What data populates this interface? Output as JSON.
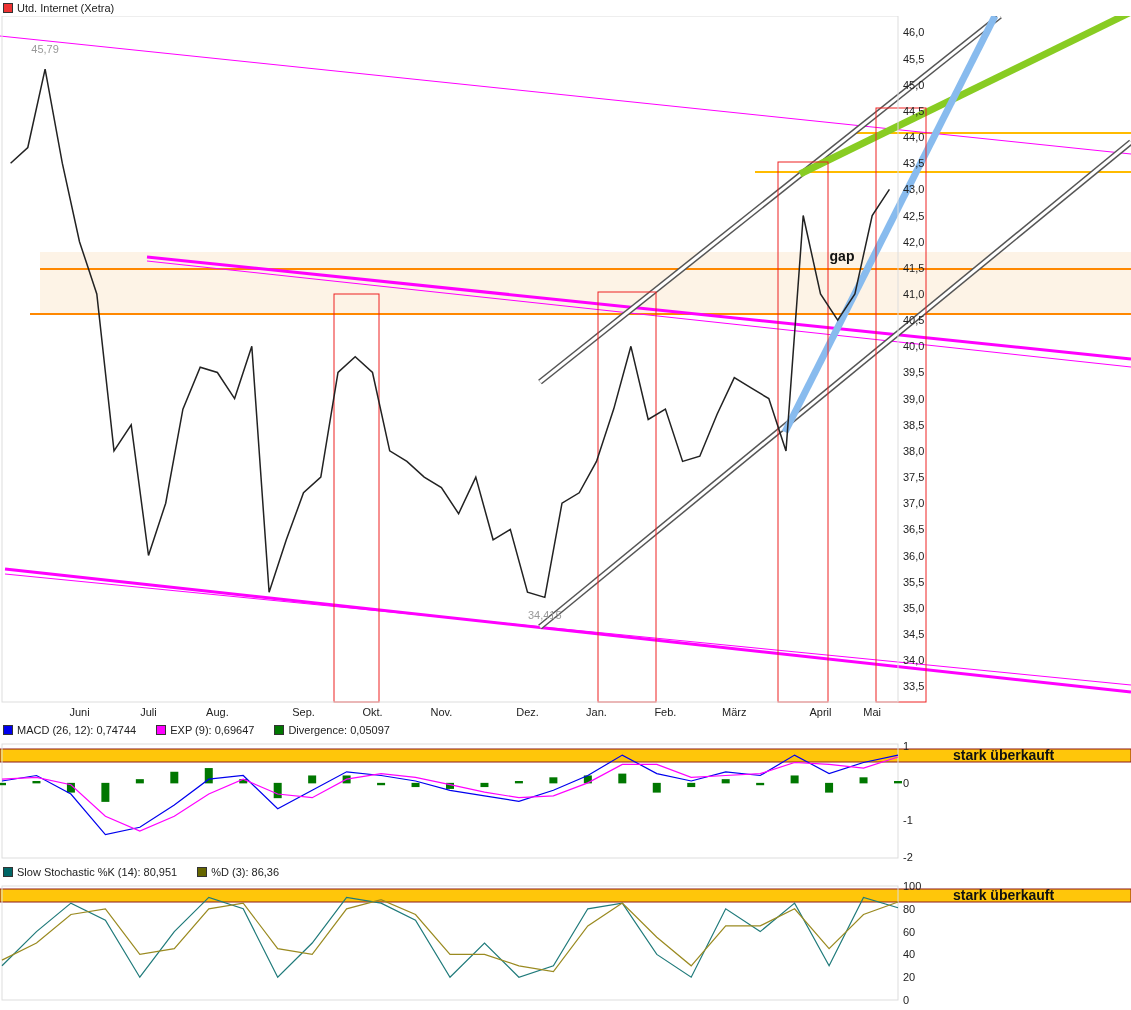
{
  "price_panel": {
    "legend": {
      "label": "Utd. Internet (Xetra)",
      "color": "#ee3333"
    },
    "chart_data": {
      "type": "line",
      "categories": [
        null,
        null,
        null,
        null,
        "Juni",
        null,
        null,
        null,
        "Juli",
        null,
        null,
        null,
        "Aug.",
        null,
        null,
        null,
        null,
        "Sep.",
        null,
        null,
        null,
        "Okt.",
        null,
        null,
        null,
        "Nov.",
        null,
        null,
        null,
        null,
        "Dez.",
        null,
        null,
        null,
        "Jan.",
        null,
        null,
        null,
        "Feb.",
        null,
        null,
        null,
        "März",
        null,
        null,
        null,
        null,
        "April",
        null,
        null,
        "Mai",
        null
      ],
      "series": [
        {
          "color": "#222222",
          "values": [
            43.5,
            43.8,
            45.3,
            43.5,
            42.0,
            41.0,
            38.0,
            38.5,
            36.0,
            37.0,
            38.8,
            39.6,
            39.5,
            39.0,
            40.0,
            35.3,
            36.3,
            37.2,
            37.5,
            39.5,
            39.8,
            39.5,
            38.0,
            37.8,
            37.5,
            37.3,
            36.8,
            37.5,
            36.3,
            36.5,
            35.3,
            35.2,
            37.0,
            37.2,
            37.8,
            38.8,
            40.0,
            38.6,
            38.8,
            37.8,
            37.9,
            38.7,
            39.4,
            39.2,
            39.0,
            38.0,
            42.5,
            41.0,
            40.5,
            41.0,
            42.5,
            43.0
          ]
        }
      ],
      "ylim": [
        33.2,
        46.2
      ],
      "yticks": [
        {
          "value": 33.5,
          "label": "33,5"
        },
        {
          "value": 34,
          "label": "34,0"
        },
        {
          "value": 34.5,
          "label": "34,5"
        },
        {
          "value": 35,
          "label": "35,0"
        },
        {
          "value": 35.5,
          "label": "35,5"
        },
        {
          "value": 36,
          "label": "36,0"
        },
        {
          "value": 36.5,
          "label": "36,5"
        },
        {
          "value": 37,
          "label": "37,0"
        },
        {
          "value": 37.5,
          "label": "37,5"
        },
        {
          "value": 38,
          "label": "38,0"
        },
        {
          "value": 38.5,
          "label": "38,5"
        },
        {
          "value": 39,
          "label": "39,0"
        },
        {
          "value": 39.5,
          "label": "39,5"
        },
        {
          "value": 40,
          "label": "40,0"
        },
        {
          "value": 40.5,
          "label": "40,5"
        },
        {
          "value": 41,
          "label": "41,0"
        },
        {
          "value": 41.5,
          "label": "41,5"
        },
        {
          "value": 42,
          "label": "42,0"
        },
        {
          "value": 42.5,
          "label": "42,5"
        },
        {
          "value": 43,
          "label": "43,0"
        },
        {
          "value": 43.5,
          "label": "43,5"
        },
        {
          "value": 44,
          "label": "44,0"
        },
        {
          "value": 44.5,
          "label": "44,5"
        },
        {
          "value": 45,
          "label": "45,0"
        },
        {
          "value": 45.5,
          "label": "45,5"
        },
        {
          "value": 46,
          "label": "46,0"
        }
      ],
      "annotations": [
        "45,79",
        "34,415",
        "gap"
      ]
    }
  },
  "macd_panel": {
    "legend": [
      {
        "label": "MACD (26, 12): 0,74744",
        "color": "#0000ee"
      },
      {
        "label": "EXP (9): 0,69647",
        "color": "#ff00ff"
      },
      {
        "label": "Divergence: 0,05097",
        "color": "#007700"
      }
    ],
    "chart_data": {
      "type": "line",
      "categories": [
        null,
        null,
        null,
        null,
        null,
        null,
        null,
        null,
        null,
        null,
        null,
        null,
        null,
        null,
        null,
        null,
        null,
        null,
        null,
        null,
        null,
        null,
        null,
        null,
        null,
        null,
        null
      ],
      "series": [
        {
          "color": "#0000ee",
          "values": [
            0.05,
            0.2,
            -0.3,
            -1.4,
            -1.2,
            -0.6,
            0.1,
            0.2,
            -0.7,
            -0.2,
            0.3,
            0.2,
            0.05,
            -0.2,
            -0.35,
            -0.5,
            -0.2,
            0.2,
            0.75,
            0.25,
            0.05,
            0.3,
            0.2,
            0.75,
            0.25,
            0.55,
            0.75
          ]
        },
        {
          "color": "#ff00ff",
          "values": [
            0.1,
            0.15,
            -0.05,
            -0.9,
            -1.3,
            -0.9,
            -0.3,
            0.1,
            -0.3,
            -0.4,
            0.1,
            0.25,
            0.15,
            -0.05,
            -0.25,
            -0.4,
            -0.35,
            0,
            0.5,
            0.5,
            0.15,
            0.2,
            0.25,
            0.55,
            0.5,
            0.4,
            0.7
          ]
        },
        {
          "color": "#007700",
          "type": "bar",
          "values": [
            -0.05,
            0.05,
            -0.25,
            -0.5,
            0.1,
            0.3,
            0.4,
            0.1,
            -0.4,
            0.2,
            0.2,
            -0.05,
            -0.1,
            -0.15,
            -0.1,
            0.05,
            0.15,
            0.2,
            0.25,
            -0.25,
            -0.1,
            0.1,
            -0.05,
            0.2,
            -0.25,
            0.15,
            0.05
          ]
        }
      ],
      "ylim": [
        -2.03,
        1.05
      ],
      "yticks": [
        -2,
        -1,
        0,
        1
      ]
    },
    "banner": "stark überkauft"
  },
  "stochastic_panel": {
    "legend": [
      {
        "label": "Slow Stochastic %K (14): 80,951",
        "color": "#006666"
      },
      {
        "label": "%D (3): 86,36",
        "color": "#666600"
      }
    ],
    "chart_data": {
      "type": "line",
      "categories": [
        null,
        null,
        null,
        null,
        null,
        null,
        null,
        null,
        null,
        null,
        null,
        null,
        null,
        null,
        null,
        null,
        null,
        null,
        null,
        null,
        null,
        null,
        null,
        null,
        null,
        null,
        null
      ],
      "series": [
        {
          "color": "#1f7a7a",
          "values": [
            30,
            60,
            85,
            70,
            20,
            60,
            90,
            80,
            20,
            50,
            90,
            85,
            70,
            20,
            50,
            20,
            30,
            80,
            85,
            40,
            20,
            80,
            60,
            85,
            30,
            90,
            81
          ]
        },
        {
          "color": "#9a8a20",
          "values": [
            35,
            50,
            75,
            80,
            40,
            45,
            80,
            85,
            45,
            40,
            80,
            88,
            75,
            40,
            40,
            30,
            25,
            65,
            85,
            55,
            30,
            65,
            65,
            80,
            45,
            75,
            86
          ]
        }
      ],
      "ylim": [
        0,
        100
      ],
      "yticks": [
        0,
        20,
        40,
        60,
        80,
        100
      ]
    },
    "banner": "stark überkauft"
  }
}
